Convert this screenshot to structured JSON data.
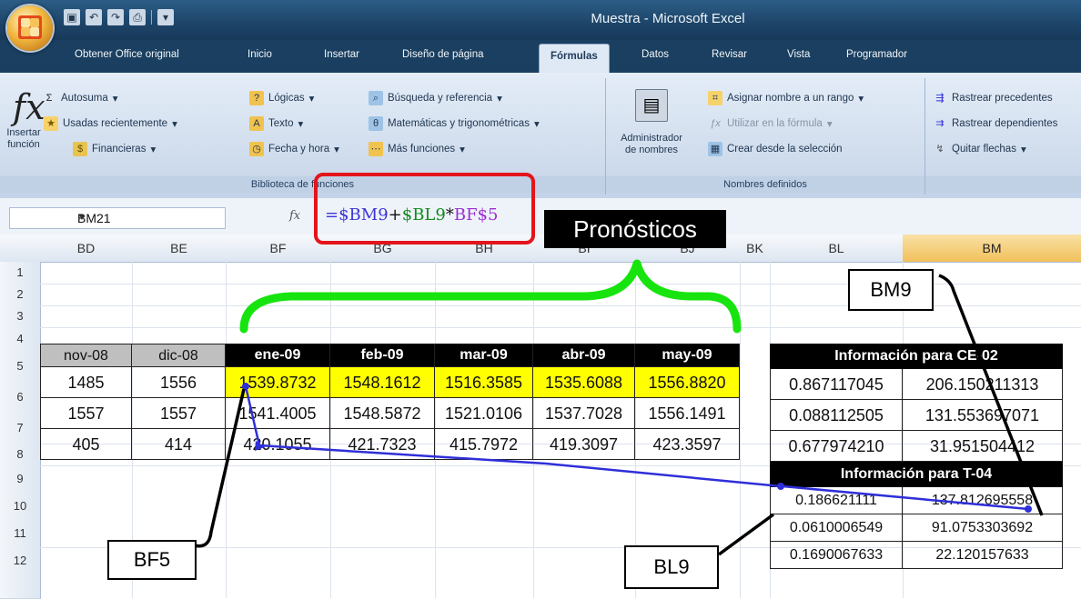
{
  "window": {
    "title": "Muestra - Microsoft Excel"
  },
  "quick_access": {
    "icons": [
      "save-icon",
      "undo-icon",
      "redo-icon",
      "print-icon"
    ]
  },
  "tabs": [
    {
      "label": "Obtener Office original"
    },
    {
      "label": "Inicio"
    },
    {
      "label": "Insertar"
    },
    {
      "label": "Diseño de página"
    },
    {
      "label": "Fórmulas",
      "active": true
    },
    {
      "label": "Datos"
    },
    {
      "label": "Revisar"
    },
    {
      "label": "Vista"
    },
    {
      "label": "Programador"
    }
  ],
  "ribbon": {
    "insert_function": {
      "line1": "Insertar",
      "line2": "función"
    },
    "library": {
      "autosum": "Autosuma",
      "recent": "Usadas recientemente",
      "financial": "Financieras",
      "logical": "Lógicas",
      "text": "Texto",
      "datetime": "Fecha y hora",
      "lookup": "Búsqueda y referencia",
      "math": "Matemáticas y trigonométricas",
      "more": "Más funciones",
      "title": "Biblioteca de funciones"
    },
    "names": {
      "manager_line1": "Administrador",
      "manager_line2": "de nombres",
      "assign": "Asignar nombre a un rango",
      "use_in_formula": "Utilizar en la fórmula",
      "create_from_selection": "Crear desde la selección",
      "title": "Nombres definidos"
    },
    "audit": {
      "trace_precedents": "Rastrear precedentes",
      "trace_dependents": "Rastrear dependientes",
      "remove_arrows": "Quitar flechas"
    }
  },
  "formula_bar": {
    "name_box": "BM21",
    "fx": "fx",
    "formula_parts": {
      "p1": "=$BM9",
      "p2": "+",
      "p3": "$BL9",
      "p4": "*",
      "p5": "BF$5"
    },
    "colors": {
      "bm": "#3b35d6",
      "bl": "#138a1a",
      "bf": "#9b2fd1",
      "op": "#111111"
    }
  },
  "columns": [
    "BD",
    "BE",
    "BF",
    "BG",
    "BH",
    "BI",
    "BJ",
    "BK",
    "BL",
    "BM"
  ],
  "rows": [
    "1",
    "2",
    "3",
    "4",
    "5",
    "6",
    "7",
    "8",
    "9",
    "10",
    "11",
    "12"
  ],
  "table": {
    "headers": [
      "nov-08",
      "dic-08",
      "ene-09",
      "feb-09",
      "mar-09",
      "abr-09",
      "may-09"
    ],
    "row5": [
      "1485",
      "1556",
      "1539.8732",
      "1548.1612",
      "1516.3585",
      "1535.6088",
      "1556.8820"
    ],
    "row6": [
      "1557",
      "1557",
      "1541.4005",
      "1548.5872",
      "1521.0106",
      "1537.7028",
      "1556.1491"
    ],
    "row7": [
      "405",
      "414",
      "420.1055",
      "421.7323",
      "415.7972",
      "419.3097",
      "423.3597"
    ]
  },
  "info_ce": {
    "title": "Información para CE-02",
    "rows": [
      [
        "0.867117045",
        "206.150211313"
      ],
      [
        "0.088112505",
        "131.553697071"
      ],
      [
        "0.677974210",
        "31.951504412"
      ]
    ]
  },
  "info_t": {
    "title": "Información para T-04",
    "rows": [
      [
        "0.186621111",
        "137.812695558"
      ],
      [
        "0.0610006549",
        "91.0753303692"
      ],
      [
        "0.1690067633",
        "22.120157633"
      ]
    ]
  },
  "annotations": {
    "pronosticos": "Pronósticos",
    "bm9": "BM9",
    "bf5": "BF5",
    "bl9": "BL9"
  },
  "colors": {
    "accent_red": "#e3151b",
    "brace_green": "#17e40f",
    "highlight_yellow": "#ffff00",
    "trace_arrow": "#2f2fd9"
  }
}
